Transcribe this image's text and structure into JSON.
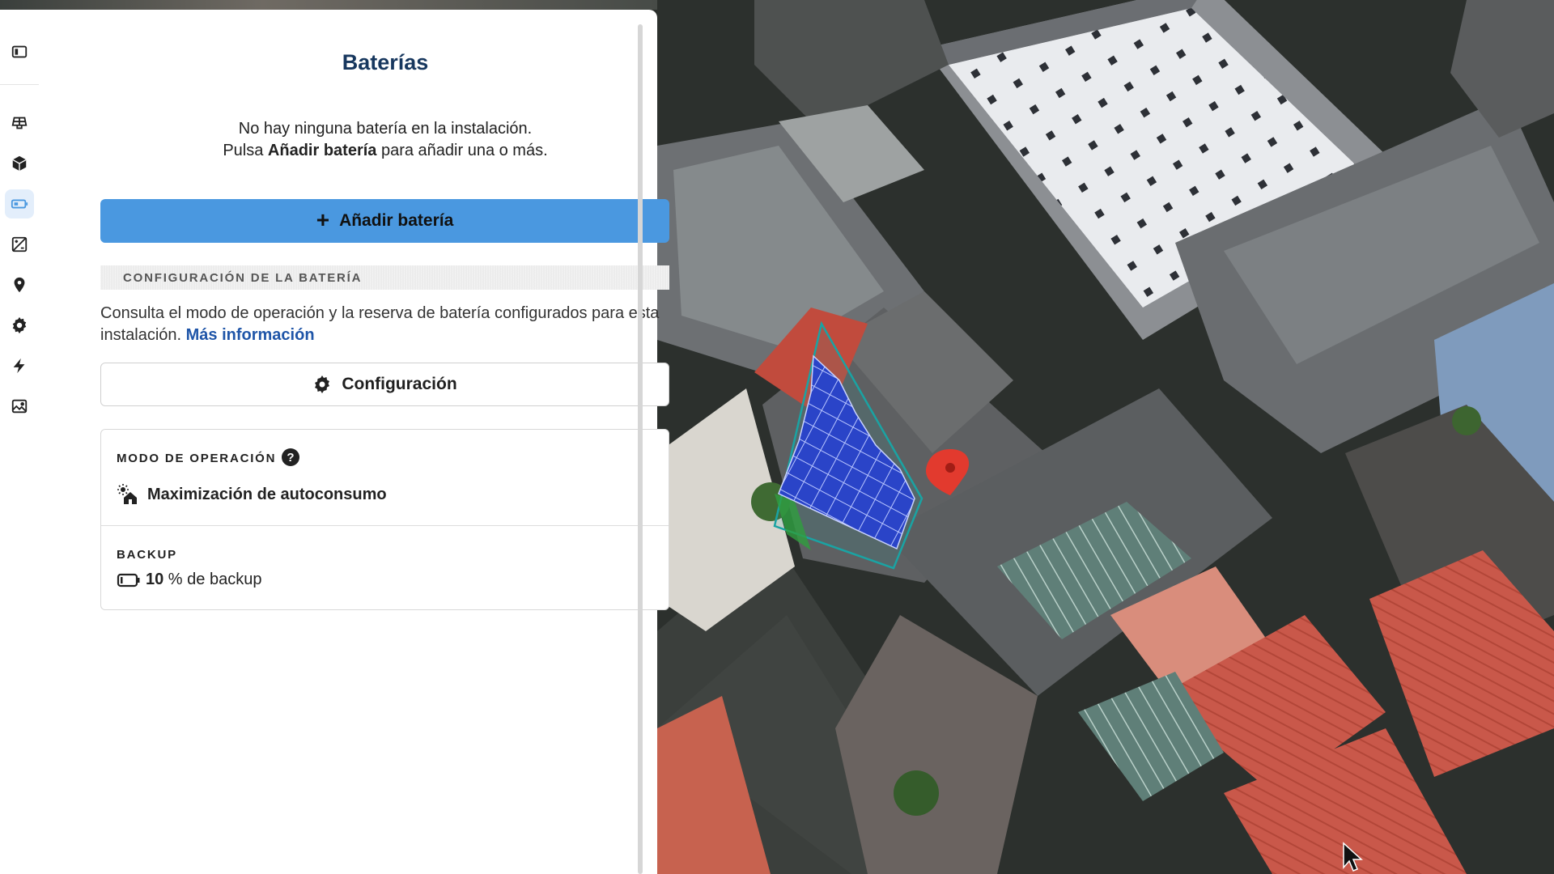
{
  "panel": {
    "title": "Baterías",
    "empty_line1": "No hay ninguna batería en la instalación.",
    "empty_line2_pre": "Pulsa ",
    "empty_line2_bold": "Añadir batería",
    "empty_line2_post": " para añadir una o más.",
    "add_button": "Añadir batería",
    "section_title": "CONFIGURACIÓN DE LA BATERÍA",
    "description": "Consulta el modo de operación y la reserva de batería configurados para esta instalación. ",
    "more_info": "Más información",
    "config_button": "Configuración",
    "operation_mode_label": "MODO DE OPERACIÓN",
    "help_glyph": "?",
    "operation_mode_value": "Maximización de autoconsumo",
    "backup_label": "BACKUP",
    "backup_value": "10",
    "backup_suffix": " % de backup"
  },
  "rail": {
    "items": [
      {
        "name": "toggle-sidebar-icon",
        "active": false
      },
      {
        "name": "solar-panel-icon",
        "active": false
      },
      {
        "name": "cube-icon",
        "active": false
      },
      {
        "name": "battery-icon",
        "active": true
      },
      {
        "name": "diagonal-chart-icon",
        "active": false
      },
      {
        "name": "location-pin-icon",
        "active": false
      },
      {
        "name": "gear-icon",
        "active": false
      },
      {
        "name": "lightning-icon",
        "active": false
      },
      {
        "name": "image-icon",
        "active": false
      }
    ]
  },
  "colors": {
    "primary_button": "#4a98e0",
    "title": "#17375e",
    "link": "#1f55a8",
    "map_pin": "#e23a2e",
    "panel_array_outline": "#1aa3a3"
  }
}
